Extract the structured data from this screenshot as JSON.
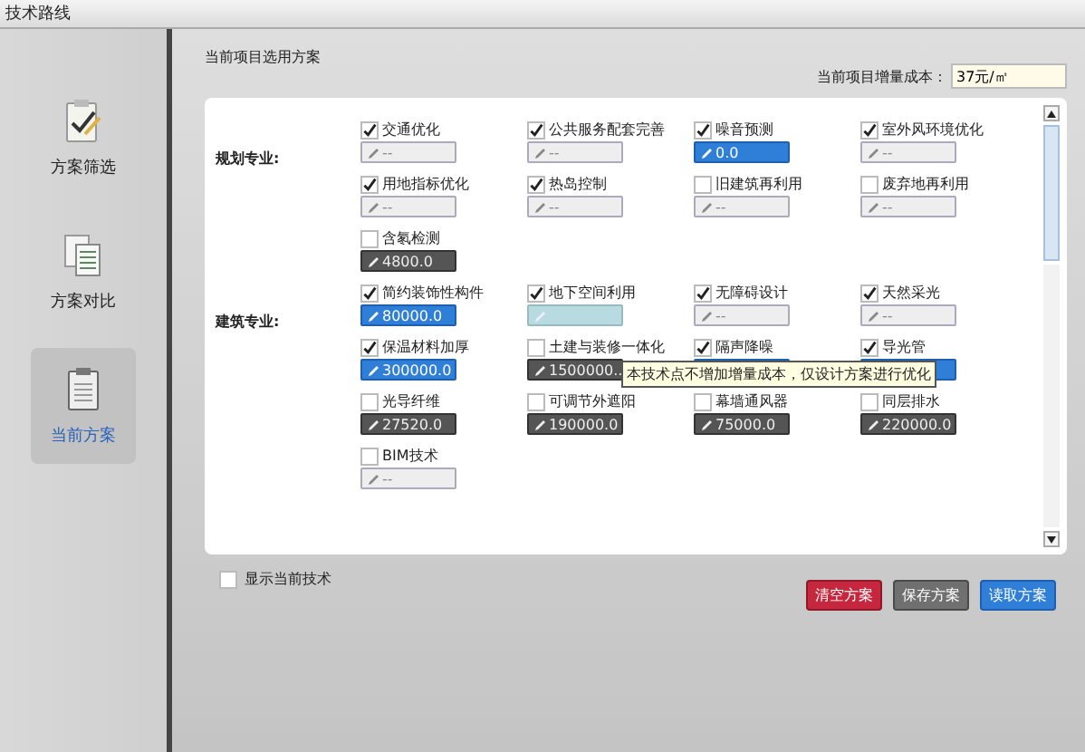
{
  "window": {
    "title": "技术路线"
  },
  "sidebar": {
    "items": [
      {
        "label": "方案筛选",
        "kind": "filter",
        "selected": false
      },
      {
        "label": "方案对比",
        "kind": "compare",
        "selected": false
      },
      {
        "label": "当前方案",
        "kind": "current",
        "selected": true
      }
    ]
  },
  "header": {
    "title": "当前项目选用方案",
    "cost_label": "当前项目增量成本：",
    "cost_value": "37元/㎡"
  },
  "groups": [
    {
      "label": "规划专业:",
      "items": [
        {
          "label": "交通优化",
          "checked": true,
          "field": {
            "kind": "empty",
            "value": "--"
          }
        },
        {
          "label": "公共服务配套完善",
          "checked": true,
          "field": {
            "kind": "empty",
            "value": "--"
          }
        },
        {
          "label": "噪音预测",
          "checked": true,
          "field": {
            "kind": "active",
            "value": "0.0"
          }
        },
        {
          "label": "室外风环境优化",
          "checked": true,
          "field": {
            "kind": "empty",
            "value": "--"
          }
        },
        {
          "label": "用地指标优化",
          "checked": true,
          "field": {
            "kind": "empty",
            "value": "--"
          }
        },
        {
          "label": "热岛控制",
          "checked": true,
          "field": {
            "kind": "empty",
            "value": "--"
          }
        },
        {
          "label": "旧建筑再利用",
          "checked": false,
          "field": {
            "kind": "empty",
            "value": "--"
          }
        },
        {
          "label": "废弃地再利用",
          "checked": false,
          "field": {
            "kind": "empty",
            "value": "--"
          }
        },
        {
          "label": "含氡检测",
          "checked": false,
          "field": {
            "kind": "inactive",
            "value": "4800.0"
          }
        }
      ]
    },
    {
      "label": "建筑专业:",
      "items": [
        {
          "label": "简约装饰性构件",
          "checked": true,
          "field": {
            "kind": "active",
            "value": "80000.0"
          }
        },
        {
          "label": "地下空间利用",
          "checked": true,
          "field": {
            "kind": "hover"
          }
        },
        {
          "label": "无障碍设计",
          "checked": true,
          "field": {
            "kind": "empty",
            "value": "--"
          }
        },
        {
          "label": "天然采光",
          "checked": true,
          "field": {
            "kind": "empty",
            "value": "--"
          }
        },
        {
          "label": "保温材料加厚",
          "checked": true,
          "field": {
            "kind": "active",
            "value": "300000.0"
          }
        },
        {
          "label": "土建与装修一体化",
          "checked": false,
          "field": {
            "kind": "inactive",
            "value": "1500000.."
          }
        },
        {
          "label": "隔声降噪",
          "checked": true,
          "field": {
            "kind": "active",
            "covered": true
          }
        },
        {
          "label": "导光管",
          "checked": true,
          "field": {
            "kind": "active",
            "covered": true
          }
        },
        {
          "label": "光导纤维",
          "checked": false,
          "field": {
            "kind": "inactive",
            "value": "27520.0"
          }
        },
        {
          "label": "可调节外遮阳",
          "checked": false,
          "field": {
            "kind": "inactive",
            "value": "190000.0"
          }
        },
        {
          "label": "幕墙通风器",
          "checked": false,
          "field": {
            "kind": "inactive",
            "value": "75000.0"
          }
        },
        {
          "label": "同层排水",
          "checked": false,
          "field": {
            "kind": "inactive",
            "value": "220000.0"
          }
        },
        {
          "label": "BIM技术",
          "checked": false,
          "field": {
            "kind": "empty",
            "value": "--"
          }
        }
      ]
    }
  ],
  "tooltip": "本技术点不增加增量成本，仅设计方案进行优化",
  "show_current": {
    "label": "显示当前技术",
    "checked": false
  },
  "buttons": [
    {
      "label": "清空方案",
      "kind": "danger"
    },
    {
      "label": "保存方案",
      "kind": "neutral"
    },
    {
      "label": "读取方案",
      "kind": "primary"
    }
  ]
}
